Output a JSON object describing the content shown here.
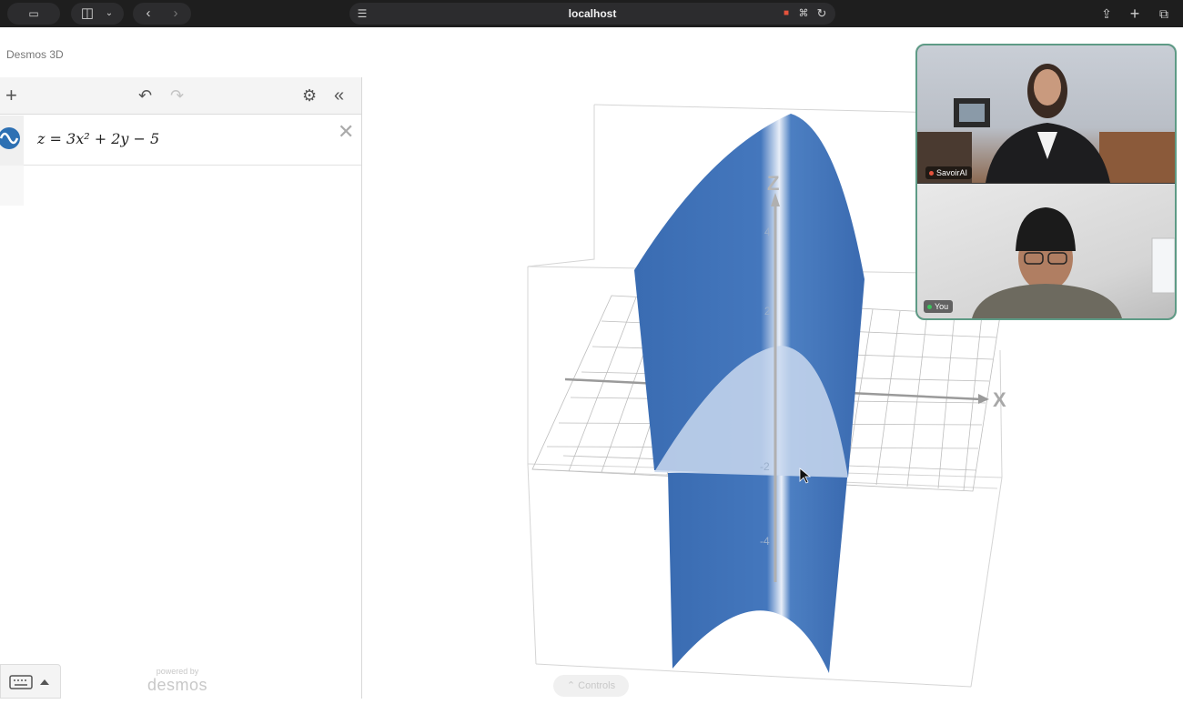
{
  "browser": {
    "url": "localhost"
  },
  "app": {
    "title": "Desmos 3D"
  },
  "expression_list": {
    "expressions": [
      {
        "latex_display": "z = 3x² + 2y − 5",
        "color": "#2d70b3"
      }
    ]
  },
  "branding": {
    "powered_by": "powered by",
    "brand": "desmos"
  },
  "graph": {
    "axis_labels": {
      "z": "Z",
      "x": "X"
    },
    "z_ticks": [
      "4",
      "2",
      "-2",
      "-4"
    ],
    "surface_color": "#3f72b8",
    "controls_label": "Controls"
  },
  "video_call": {
    "participants": [
      {
        "name": "SavoirAI",
        "status_color": "#e5533d"
      },
      {
        "name": "You",
        "status_color": "#3cc35d"
      }
    ]
  },
  "icons": {
    "toolbar_left": [
      "sidebar-toggle-icon",
      "chevron-down-icon",
      "back-icon",
      "forward-icon",
      "tab-overview-icon"
    ],
    "toolbar_right": [
      "share-icon",
      "new-tab-icon",
      "tabs-icon"
    ],
    "panel": [
      "add-icon",
      "undo-icon",
      "redo-icon",
      "gear-icon",
      "collapse-icon"
    ]
  }
}
